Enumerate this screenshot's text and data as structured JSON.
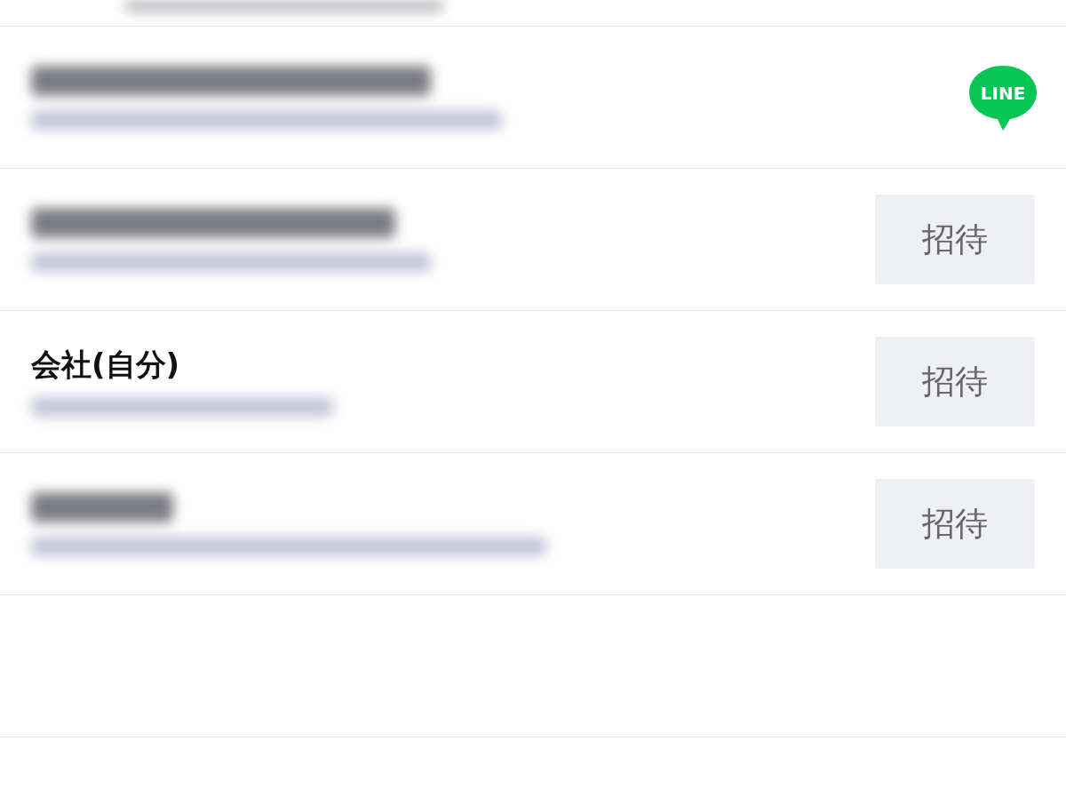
{
  "contacts": [
    {
      "kind": "line",
      "action": "LINE"
    },
    {
      "kind": "invite",
      "action": "招待"
    },
    {
      "kind": "invite",
      "name": "会社(自分)",
      "action": "招待"
    },
    {
      "kind": "invite",
      "action": "招待"
    }
  ]
}
